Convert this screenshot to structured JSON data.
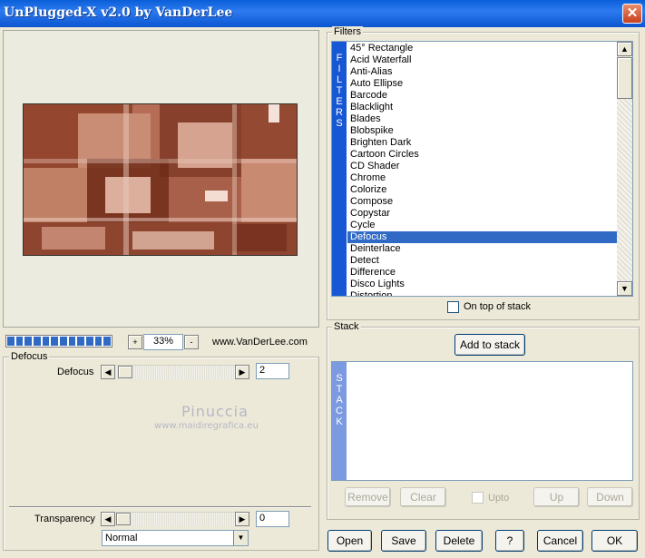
{
  "window": {
    "title": "UnPlugged-X v2.0 by VanDerLee",
    "close_glyph": "✕"
  },
  "preview": {
    "zoom_decrement": "-",
    "zoom_increment": "+",
    "zoom_value": "33%",
    "website": "www.VanDerLee.com",
    "progress_segments": 12
  },
  "filter_params": {
    "group_label": "Defocus",
    "param_label": "Defocus",
    "param_value": "2",
    "param_level": 0.02,
    "watermark_name": "Pinuccia",
    "watermark_url": "www.maidiregrafica.eu"
  },
  "transparency": {
    "label": "Transparency",
    "value": "0",
    "level": 0.0,
    "blend_mode": "Normal"
  },
  "filters": {
    "group_label": "Filters",
    "vertical_label": [
      "F",
      "I",
      "L",
      "T",
      "E",
      "R",
      "S"
    ],
    "items": [
      "45° Rectangle",
      "Acid Waterfall",
      "Anti-Alias",
      "Auto Ellipse",
      "Barcode",
      "Blacklight",
      "Blades",
      "Blobspike",
      "Brighten Dark",
      "Cartoon Circles",
      "CD Shader",
      "Chrome",
      "Colorize",
      "Compose",
      "Copystar",
      "Cycle",
      "Defocus",
      "Deinterlace",
      "Detect",
      "Difference",
      "Disco Lights",
      "Distortion"
    ],
    "selected": "Defocus",
    "on_top_label": "On top of stack"
  },
  "stack": {
    "group_label": "Stack",
    "add_label": "Add to stack",
    "vertical_label": [
      "S",
      "T",
      "A",
      "C",
      "K"
    ],
    "remove_label": "Remove",
    "clear_label": "Clear",
    "upto_label": "Upto",
    "up_label": "Up",
    "down_label": "Down"
  },
  "footer": {
    "open_label": "Open",
    "save_label": "Save",
    "delete_label": "Delete",
    "help_label": "?",
    "cancel_label": "Cancel",
    "ok_label": "OK"
  },
  "icons": {
    "arrow_left": "◀",
    "arrow_right": "▶",
    "arrow_up": "▲",
    "arrow_down": "▼",
    "dropdown": "▼"
  },
  "colors": {
    "selection": "#316ac5",
    "filters_band": "#1857d3",
    "stack_band": "#7b9ae0",
    "preview_base": "#a0523a"
  }
}
